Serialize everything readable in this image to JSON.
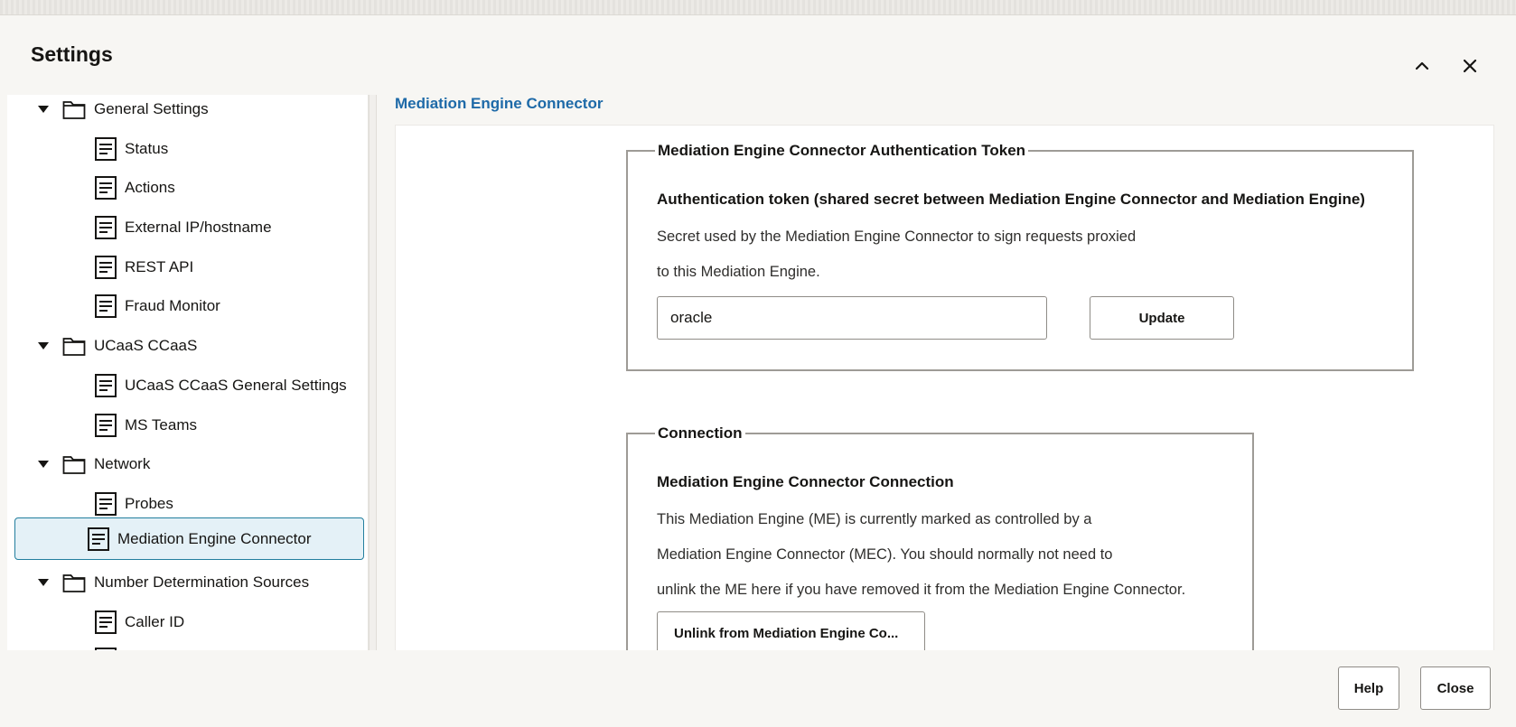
{
  "dialog": {
    "title": "Settings",
    "collapse_icon": "chevron-up-icon",
    "close_icon": "close-icon"
  },
  "tree": {
    "items": [
      {
        "type": "folder",
        "label": "General Settings",
        "expanded": true
      },
      {
        "type": "leaf",
        "label": "Status"
      },
      {
        "type": "leaf",
        "label": "Actions"
      },
      {
        "type": "leaf",
        "label": "External IP/hostname"
      },
      {
        "type": "leaf",
        "label": "REST API"
      },
      {
        "type": "leaf",
        "label": "Fraud Monitor"
      },
      {
        "type": "folder",
        "label": "UCaaS CCaaS",
        "expanded": true
      },
      {
        "type": "leaf",
        "label": "UCaaS CCaaS General Settings"
      },
      {
        "type": "leaf",
        "label": "MS Teams"
      },
      {
        "type": "folder",
        "label": "Network",
        "expanded": true
      },
      {
        "type": "leaf",
        "label": "Probes"
      },
      {
        "type": "leaf",
        "label": "Mediation Engine Connector",
        "selected": true
      },
      {
        "type": "folder",
        "label": "Number Determination Sources",
        "expanded": true
      },
      {
        "type": "leaf",
        "label": "Caller ID"
      }
    ]
  },
  "content": {
    "section_title": "Mediation Engine Connector",
    "token_box": {
      "legend": "Mediation Engine Connector Authentication Token",
      "heading": "Authentication token (shared secret between Mediation Engine Connector and Mediation Engine)",
      "desc_line1": "Secret used by the Mediation Engine Connector to sign requests proxied",
      "desc_line2": "to this Mediation Engine.",
      "input_value": "oracle",
      "update_label": "Update"
    },
    "connection_box": {
      "legend": "Connection",
      "heading": "Mediation Engine Connector Connection",
      "desc_line1": "This Mediation Engine (ME) is currently marked as controlled by a",
      "desc_line2": "Mediation Engine Connector (MEC). You should normally not need to",
      "desc_line3": "unlink the ME here if you have removed it from the Mediation Engine Connector.",
      "unlink_label": "Unlink from Mediation Engine Co..."
    }
  },
  "footer": {
    "help_label": "Help",
    "close_label": "Close"
  }
}
